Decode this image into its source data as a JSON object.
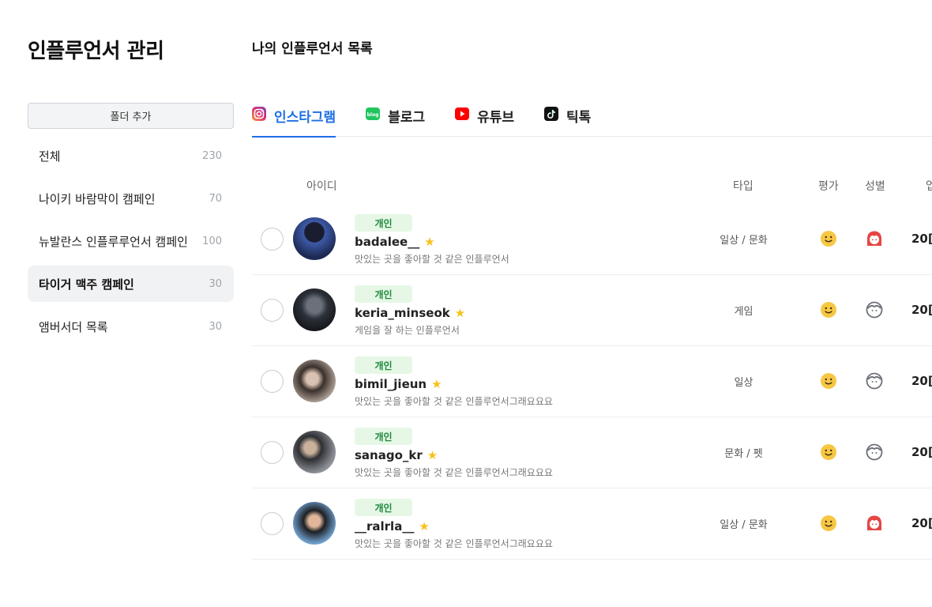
{
  "page_title": "인플루언서 관리",
  "section_title": "나의 인플루언서 목록",
  "sidebar": {
    "add_folder_label": "폴더 추가",
    "folders": [
      {
        "name": "전체",
        "count": "230",
        "active": false
      },
      {
        "name": "나이키 바람막이 캠페인",
        "count": "70",
        "active": false
      },
      {
        "name": "뉴발란스 인플루루언서 캠페인",
        "count": "100",
        "active": false
      },
      {
        "name": "타이거 맥주 캠페인",
        "count": "30",
        "active": true
      },
      {
        "name": "앰버서더 목록",
        "count": "30",
        "active": false
      }
    ]
  },
  "tabs": [
    {
      "label": "인스타그램",
      "icon": "instagram-icon",
      "active": true
    },
    {
      "label": "블로그",
      "icon": "blog-icon",
      "active": false
    },
    {
      "label": "유튜브",
      "icon": "youtube-icon",
      "active": false
    },
    {
      "label": "틱톡",
      "icon": "tiktok-icon",
      "active": false
    }
  ],
  "columns": {
    "id": "아이디",
    "type": "타입",
    "rating": "평가",
    "gender": "성별",
    "date": "업"
  },
  "rows": [
    {
      "badge": "개인",
      "handle": "badalee__",
      "desc": "맛있는 곳을 좋아할 것 같은 인플루언서",
      "type": "일상 / 문화",
      "gender": "female",
      "date": "20[",
      "avatar_color": "#2b3b6e"
    },
    {
      "badge": "개인",
      "handle": "keria_minseok",
      "desc": "게임을 잘 하는 인플루언서",
      "type": "게임",
      "gender": "neutral",
      "date": "20[",
      "avatar_color": "#3a3f4a"
    },
    {
      "badge": "개인",
      "handle": "bimil_jieun",
      "desc": "맛있는 곳을 좋아할 것 같은 인플루언서그래요요요",
      "type": "일상",
      "gender": "neutral",
      "date": "20[",
      "avatar_color": "#8a7d72"
    },
    {
      "badge": "개인",
      "handle": "sanago_kr",
      "desc": "맛있는 곳을 좋아할 것 같은 인플루언서그래요요요",
      "type": "문화 / 펫",
      "gender": "neutral",
      "date": "20[",
      "avatar_color": "#5c6168"
    },
    {
      "badge": "개인",
      "handle": "__ralrla__",
      "desc": "맛있는 곳을 좋아할 것 같은 인플루언서그래요요요",
      "type": "일상 / 문화",
      "gender": "female",
      "date": "20[",
      "avatar_color": "#5c8fc0"
    }
  ],
  "colors": {
    "accent": "#1f6fe5",
    "badge_bg": "#e6f7e6",
    "badge_text": "#1c8a3c",
    "star": "#f6c21a",
    "rating_face": "#f7c744",
    "female_icon": "#e64545",
    "neutral_icon": "#6b7078"
  }
}
